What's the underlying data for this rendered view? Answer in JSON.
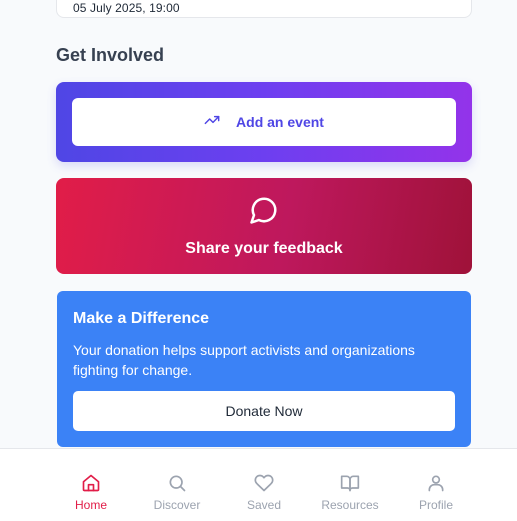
{
  "event_card": {
    "date": "05 July 2025, 19:00"
  },
  "get_involved": {
    "title": "Get Involved",
    "add_event_label": "Add an event",
    "feedback_label": "Share your feedback"
  },
  "donate": {
    "title": "Make a Difference",
    "description": "Your donation helps support activists and organizations fighting for change.",
    "button_label": "Donate Now"
  },
  "bottom_nav": {
    "items": [
      {
        "label": "Home",
        "icon": "home-icon",
        "active": true
      },
      {
        "label": "Discover",
        "icon": "search-icon",
        "active": false
      },
      {
        "label": "Saved",
        "icon": "heart-icon",
        "active": false
      },
      {
        "label": "Resources",
        "icon": "book-icon",
        "active": false
      },
      {
        "label": "Profile",
        "icon": "user-icon",
        "active": false
      }
    ]
  },
  "colors": {
    "accent_indigo": "#4f46e5",
    "feedback_rose": "#e11d48",
    "donate_blue": "#3b82f6",
    "nav_active": "#e11d48",
    "nav_inactive": "#9ca3af"
  }
}
